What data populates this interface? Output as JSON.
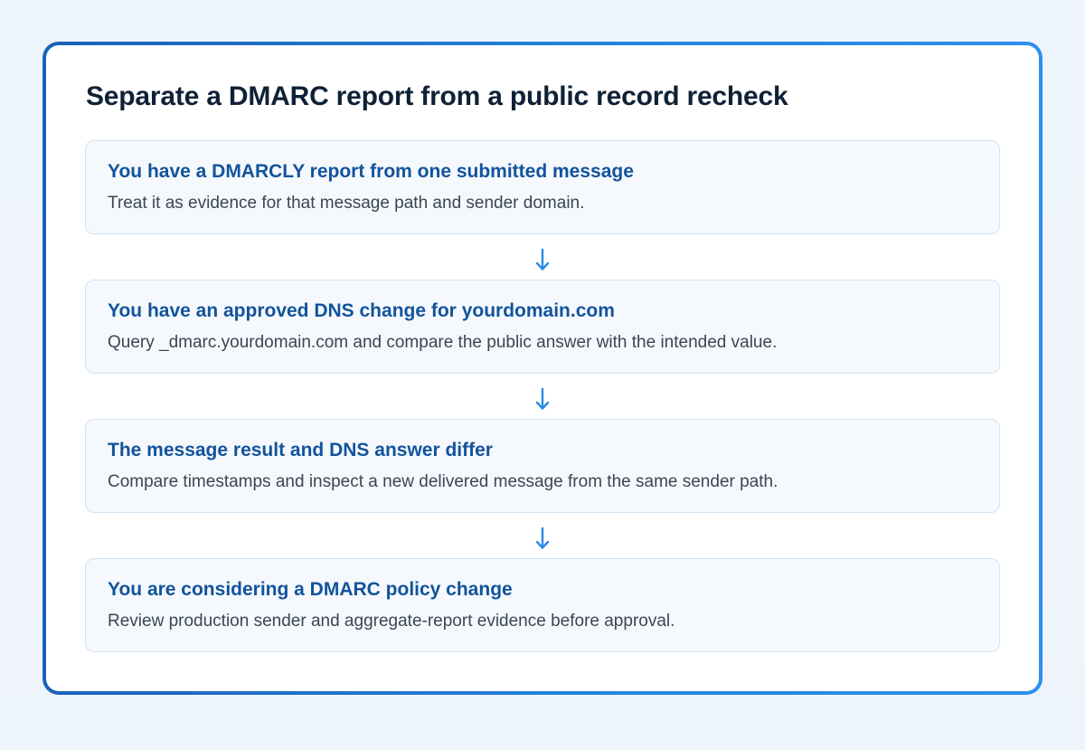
{
  "title": "Separate a DMARC report from a public record recheck",
  "steps": [
    {
      "heading": "You have a DMARCLY report from one submitted message",
      "text": "Treat it as evidence for that message path and sender domain."
    },
    {
      "heading": "You have an approved DNS change for yourdomain.com",
      "text": "Query _dmarc.yourdomain.com and compare the public answer with the intended value."
    },
    {
      "heading": "The message result and DNS answer differ",
      "text": "Compare timestamps and inspect a new delivered message from the same sender path."
    },
    {
      "heading": "You are considering a DMARC policy change",
      "text": "Review production sender and aggregate-report evidence before approval."
    }
  ],
  "colors": {
    "accent": "#1f7ad6",
    "heading": "#12539c",
    "arrow": "#2a8ae6"
  },
  "icons": {
    "connector": "arrow-down-icon"
  }
}
